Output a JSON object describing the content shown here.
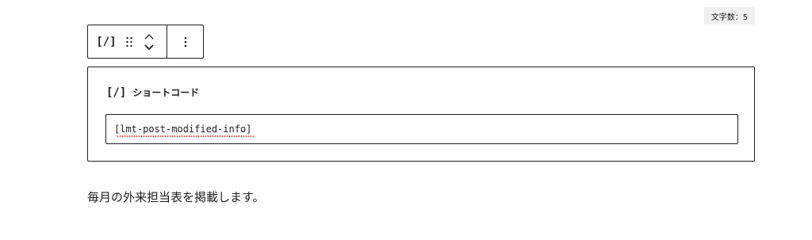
{
  "word_count": {
    "label": "文字数：5"
  },
  "toolbar": {
    "block_type_icon": "[/]",
    "icons": [
      "shortcode-icon",
      "drag-handle-icon",
      "chevron-up-icon",
      "chevron-down-icon",
      "more-vertical-icon"
    ]
  },
  "block": {
    "icon": "[/]",
    "title": "ショートコード",
    "input_value": "[lmt-post-modified-info]"
  },
  "paragraph": {
    "text": "毎月の外来担当表を掲載します。"
  },
  "colors": {
    "border": "#1e1e1e",
    "badge_bg": "#f0f0f0",
    "spellcheck": "#d94f4f"
  }
}
